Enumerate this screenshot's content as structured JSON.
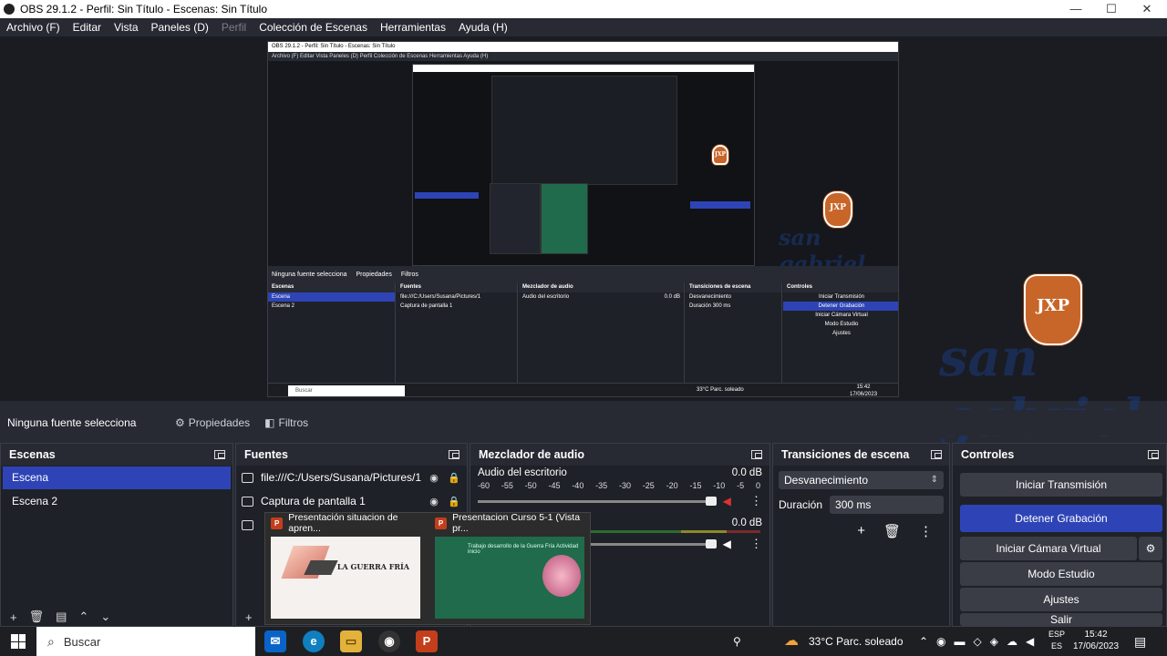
{
  "window": {
    "title": "OBS 29.1.2 - Perfil: Sin Título - Escenas: Sin Título",
    "controls": {
      "minimize": "—",
      "maximize": "☐",
      "close": "✕"
    }
  },
  "menu": {
    "items": [
      {
        "label": "Archivo (F)",
        "enabled": true
      },
      {
        "label": "Editar",
        "enabled": true
      },
      {
        "label": "Vista",
        "enabled": true
      },
      {
        "label": "Paneles (D)",
        "enabled": true
      },
      {
        "label": "Perfil",
        "enabled": false
      },
      {
        "label": "Colección de Escenas",
        "enabled": true
      },
      {
        "label": "Herramientas",
        "enabled": true
      },
      {
        "label": "Ayuda (H)",
        "enabled": true
      }
    ]
  },
  "preview": {
    "nested_title": "OBS 29.1.2 - Perfil: Sin Título - Escenas: Sin Título",
    "nested_menu": "Archivo (F)   Editar   Vista   Paneles (D)   Perfil   Colección de Escenas   Herramientas   Ayuda (H)",
    "nested_status": "Ninguna fuente selecciona",
    "nested_props": "Propiedades",
    "nested_filters": "Filtros",
    "nested_panels": {
      "scenes": "Escenas",
      "scene1": "Escena",
      "scene2": "Escena 2",
      "sources": "Fuentes",
      "src1": "file:///C:/Users/Susana/Pictures/1",
      "src2": "Captura de pantalla 1",
      "mixer": "Mezclador de audio",
      "mixer_ch": "Audio del escritorio",
      "mixer_db": "0.0 dB",
      "trans": "Transiciones de escena",
      "trans_sel": "Desvanecimiento",
      "trans_dur": "Duración",
      "trans_ms": "300 ms",
      "controls": "Controles",
      "c1": "Iniciar Transmisión",
      "c2": "Detener Grabación",
      "c3": "Iniciar Cámara Virtual",
      "c4": "Modo Estudio",
      "c5": "Ajustes"
    },
    "nested_search": "Buscar",
    "nested_weather": "33°C  Parc. soleado",
    "nested_time": "15:42",
    "nested_date": "17/06/2023",
    "crest_letters": "JXP",
    "school_text": "san gabriel"
  },
  "toolbar": {
    "no_source": "Ninguna fuente selecciona",
    "properties": "Propiedades",
    "filters": "Filtros"
  },
  "scenes": {
    "title": "Escenas",
    "items": [
      "Escena",
      "Escena 2"
    ],
    "active_index": 0
  },
  "sources": {
    "title": "Fuentes",
    "items": [
      {
        "name": "file:///C:/Users/Susana/Pictures/1"
      },
      {
        "name": "Captura de pantalla 1"
      },
      {
        "name": ""
      }
    ]
  },
  "mixer": {
    "title": "Mezclador de audio",
    "channels": [
      {
        "name": "Audio del escritorio",
        "db": "0.0 dB"
      },
      {
        "name": "",
        "db": "0.0 dB"
      }
    ],
    "scale": [
      "-60",
      "-55",
      "-50",
      "-45",
      "-40",
      "-35",
      "-30",
      "-25",
      "-20",
      "-15",
      "-10",
      "-5",
      "0"
    ]
  },
  "transitions": {
    "title": "Transiciones de escena",
    "selected": "Desvanecimiento",
    "duration_label": "Duración",
    "duration_value": "300 ms"
  },
  "controls": {
    "title": "Controles",
    "buttons": [
      {
        "label": "Iniciar Transmisión",
        "active": false
      },
      {
        "label": "Detener Grabación",
        "active": true
      },
      {
        "label": "Iniciar Cámara Virtual",
        "active": false
      },
      {
        "label": "Modo Estudio",
        "active": false
      },
      {
        "label": "Ajustes",
        "active": false
      },
      {
        "label": "Salir",
        "active": false
      }
    ]
  },
  "thumbnails": [
    {
      "title": "Presentación situacion de apren...",
      "slide_title": "LA GUERRA FRÍA"
    },
    {
      "title": "Presentacion Curso 5-1 (Vista pr...",
      "slide_title": "Trabajo desarrollo de la Guerra Fría  Actividad inicio"
    }
  ],
  "taskbar": {
    "search_placeholder": "Buscar",
    "weather": "33°C  Parc. soleado",
    "lang_top": "ESP",
    "lang_bottom": "ES",
    "time": "15:42",
    "date": "17/06/2023"
  },
  "colors": {
    "accent": "#2e44b6",
    "background": "#272a33",
    "panel": "#1f2128",
    "powerpoint": "#c43e1c"
  }
}
